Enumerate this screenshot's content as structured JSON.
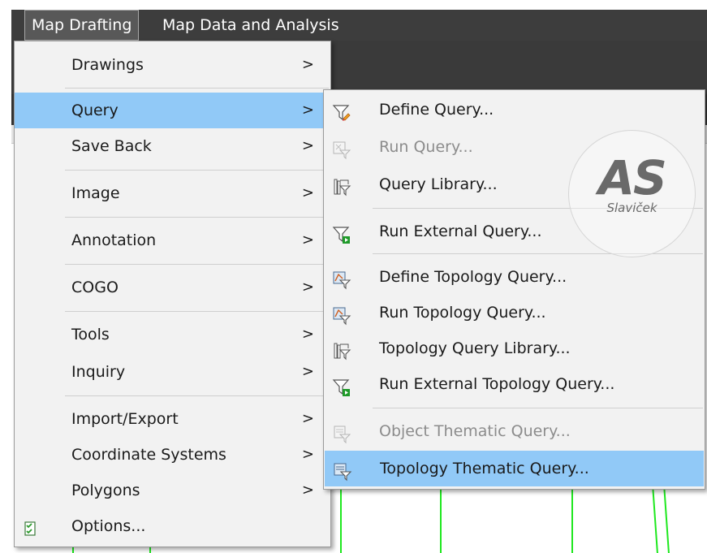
{
  "menubar": {
    "items": [
      {
        "label": "Map Drafting"
      },
      {
        "label": "Map Data and Analysis"
      }
    ]
  },
  "main_menu": {
    "items": [
      {
        "label": "Drawings",
        "arrow": ">"
      },
      {
        "label": "Query",
        "arrow": ">"
      },
      {
        "label": "Save Back",
        "arrow": ">"
      },
      {
        "label": "Image",
        "arrow": ">"
      },
      {
        "label": "Annotation",
        "arrow": ">"
      },
      {
        "label": "COGO",
        "arrow": ">"
      },
      {
        "label": "Tools",
        "arrow": ">"
      },
      {
        "label": "Inquiry",
        "arrow": ">"
      },
      {
        "label": "Import/Export",
        "arrow": ">"
      },
      {
        "label": "Coordinate Systems",
        "arrow": ">"
      },
      {
        "label": "Polygons",
        "arrow": ">"
      },
      {
        "label": "Options..."
      }
    ]
  },
  "query_submenu": {
    "items": [
      {
        "label": "Define Query...",
        "icon": "define-query-icon"
      },
      {
        "label": "Run Query...",
        "icon": "run-query-icon",
        "enabled": false
      },
      {
        "label": "Query Library...",
        "icon": "query-library-icon"
      },
      {
        "label": "Run External Query...",
        "icon": "run-external-query-icon"
      },
      {
        "label": "Define Topology Query...",
        "icon": "define-topology-query-icon"
      },
      {
        "label": "Run Topology Query...",
        "icon": "run-topology-query-icon"
      },
      {
        "label": "Topology Query Library...",
        "icon": "topology-query-library-icon"
      },
      {
        "label": "Run External Topology Query...",
        "icon": "run-external-topology-query-icon"
      },
      {
        "label": "Object Thematic Query...",
        "icon": "object-thematic-query-icon",
        "enabled": false
      },
      {
        "label": "Topology Thematic Query...",
        "icon": "topology-thematic-query-icon"
      }
    ]
  },
  "watermark": {
    "initials": "AS",
    "name": "Slaviček"
  },
  "colors": {
    "highlight": "#91c9f7",
    "menubar": "#3d3d3d",
    "cad_lines": "#1ee81e"
  }
}
